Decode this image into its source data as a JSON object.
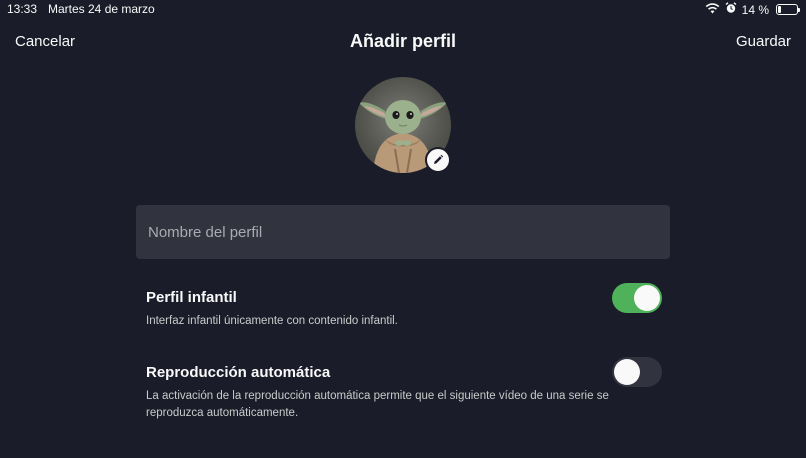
{
  "status_bar": {
    "time": "13:33",
    "date": "Martes 24 de marzo",
    "battery_text": "14 %",
    "battery_level": 0.14,
    "icons": [
      "wifi-icon",
      "alarm-icon",
      "battery-icon"
    ]
  },
  "nav": {
    "cancel_label": "Cancelar",
    "title": "Añadir perfil",
    "save_label": "Guardar"
  },
  "avatar": {
    "icon": "baby-yoda-avatar",
    "edit_icon": "pencil-icon"
  },
  "profile_name": {
    "value": "",
    "placeholder": "Nombre del perfil"
  },
  "settings": [
    {
      "title": "Perfil infantil",
      "description": "Interfaz infantil únicamente con contenido infantil.",
      "enabled": true
    },
    {
      "title": "Reproducción automática",
      "description": "La activación de la reproducción automática permite que el siguiente vídeo de una serie se reproduzca automáticamente.",
      "enabled": false
    }
  ],
  "colors": {
    "background": "#1a1d29",
    "field": "#31343e",
    "toggle_on": "#4fb25a",
    "text": "#f9f9f9"
  }
}
